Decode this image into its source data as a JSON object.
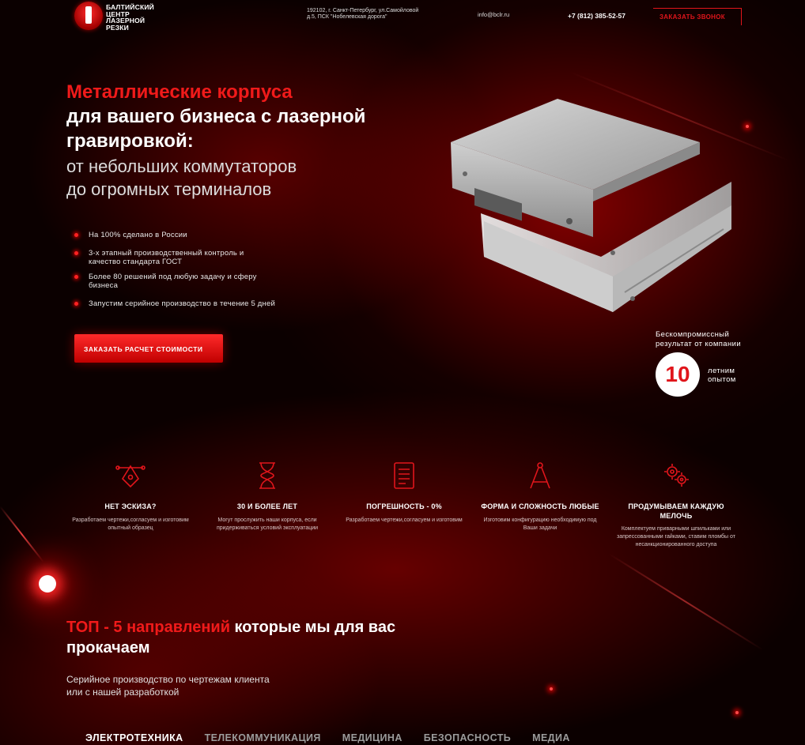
{
  "header": {
    "logo_lines": [
      "БАЛТИЙСКИЙ",
      "ЦЕНТР",
      "ЛАЗЕРНОЙ",
      "РЕЗКИ"
    ],
    "address_line1": "192102, г. Санкт-Петербург, ул.Самойловой",
    "address_line2": "д.5, ПСК \"Нобелевская дорога\"",
    "email": "info@bclr.ru",
    "phone": "+7 (812) 385-52-57",
    "callback_label": "ЗАКАЗАТЬ ЗВОНОК"
  },
  "hero": {
    "title_accent": "Металлические корпуса",
    "title_line2": "для вашего бизнеса с лазерной",
    "title_line3": "гравировкой:",
    "subtitle_line1": "от небольших коммутаторов",
    "subtitle_line2": "до огромных терминалов",
    "features": [
      "На 100% сделано в России",
      "3-х этапный производственный контроль и качество стандарта ГОСТ",
      "Более 80 решений под любую задачу и сферу бизнеса",
      "Запустим серийное производство в течение 5 дней"
    ],
    "cta_label": "ЗАКАЗАТЬ РАСЧЕТ СТОИМОСТИ"
  },
  "experience": {
    "caption_line1": "Бескомпромиссный",
    "caption_line2": "результат от компании",
    "years": "10",
    "years_line1": "летним",
    "years_line2": "опытом"
  },
  "advantages": [
    {
      "icon": "pen-tool-icon",
      "title": "НЕТ ЭСКИЗА?",
      "desc": "Разработаем чертежи,согласуем и изготовим опытный образец"
    },
    {
      "icon": "hourglass-icon",
      "title": "30 И БОЛЕЕ ЛЕТ",
      "desc": "Могут прослужить наши корпуса, если придерживаться условий эксплуатации"
    },
    {
      "icon": "document-icon",
      "title": "ПОГРЕШНОСТЬ - 0%",
      "desc": "Разработаем чертежи,согласуем и изготовим"
    },
    {
      "icon": "compass-icon",
      "title": "ФОРМА И СЛОЖНОСТЬ ЛЮБЫЕ",
      "desc": "Изготовим конфигурацию необходимую под Ваши задачи"
    },
    {
      "icon": "gears-icon",
      "title": "ПРОДУМЫВАЕМ КАЖДУЮ МЕЛОЧЬ",
      "desc": "Комплектуем приварными шпильками или запрессованными гайками, ставим пломбы от несанкционированного доступа"
    }
  ],
  "top": {
    "title_accent": "ТОП - 5 направлений",
    "title_rest": " которые мы для вас прокачаем",
    "sub_line1": "Серийное производство по чертежам клиента",
    "sub_line2": "или с нашей разработкой",
    "tabs": [
      "ЭЛЕКТРОТЕХНИКА",
      "ТЕЛЕКОММУНИКАЦИЯ",
      "МЕДИЦИНА",
      "БЕЗОПАСНОСТЬ",
      "МЕДИА"
    ]
  },
  "colors": {
    "accent": "#e0151b",
    "background": "#0b0000"
  }
}
